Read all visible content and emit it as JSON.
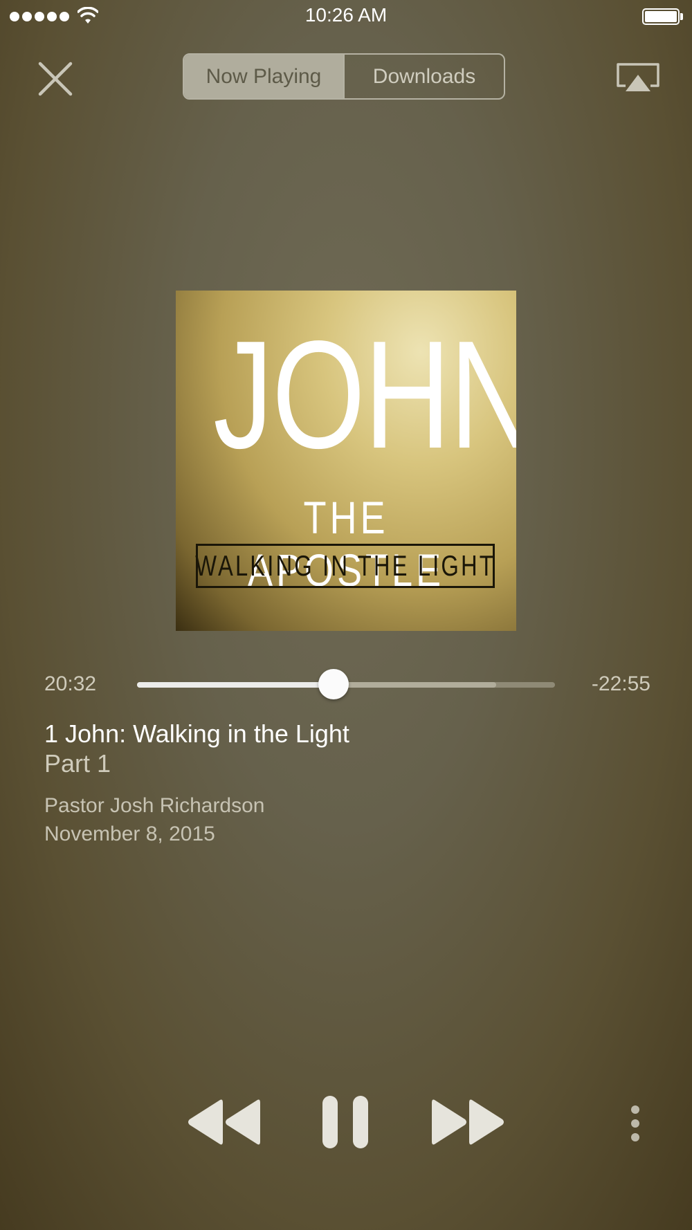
{
  "status_bar": {
    "time": "10:26 AM",
    "signal_icon": "signal-dots-icon",
    "wifi_icon": "wifi-icon",
    "battery_icon": "battery-icon"
  },
  "top_bar": {
    "close_icon": "close-icon",
    "tabs": [
      {
        "label": "Now Playing",
        "active": true
      },
      {
        "label": "Downloads",
        "active": false
      }
    ],
    "airplay_icon": "airplay-icon"
  },
  "artwork": {
    "title": "JOHN",
    "subtitle": "THE APOSTLE",
    "tagline": "WALKING IN THE LIGHT"
  },
  "player": {
    "elapsed": "20:32",
    "remaining": "-22:55",
    "progress_fraction": 0.47,
    "buffered_fraction": 0.86
  },
  "episode": {
    "title": "1 John: Walking in the Light",
    "part": "Part 1",
    "speaker": "Pastor Josh Richardson",
    "date": "November 8, 2015"
  },
  "controls": {
    "rewind_icon": "rewind-icon",
    "pause_icon": "pause-icon",
    "forward_icon": "fast-forward-icon",
    "more_icon": "more-vertical-icon"
  },
  "colors": {
    "text_primary": "#ffffff",
    "text_secondary": "#cfcbbb",
    "segment_active": "#b0ad9d",
    "control_fill": "#e6e4dc"
  }
}
